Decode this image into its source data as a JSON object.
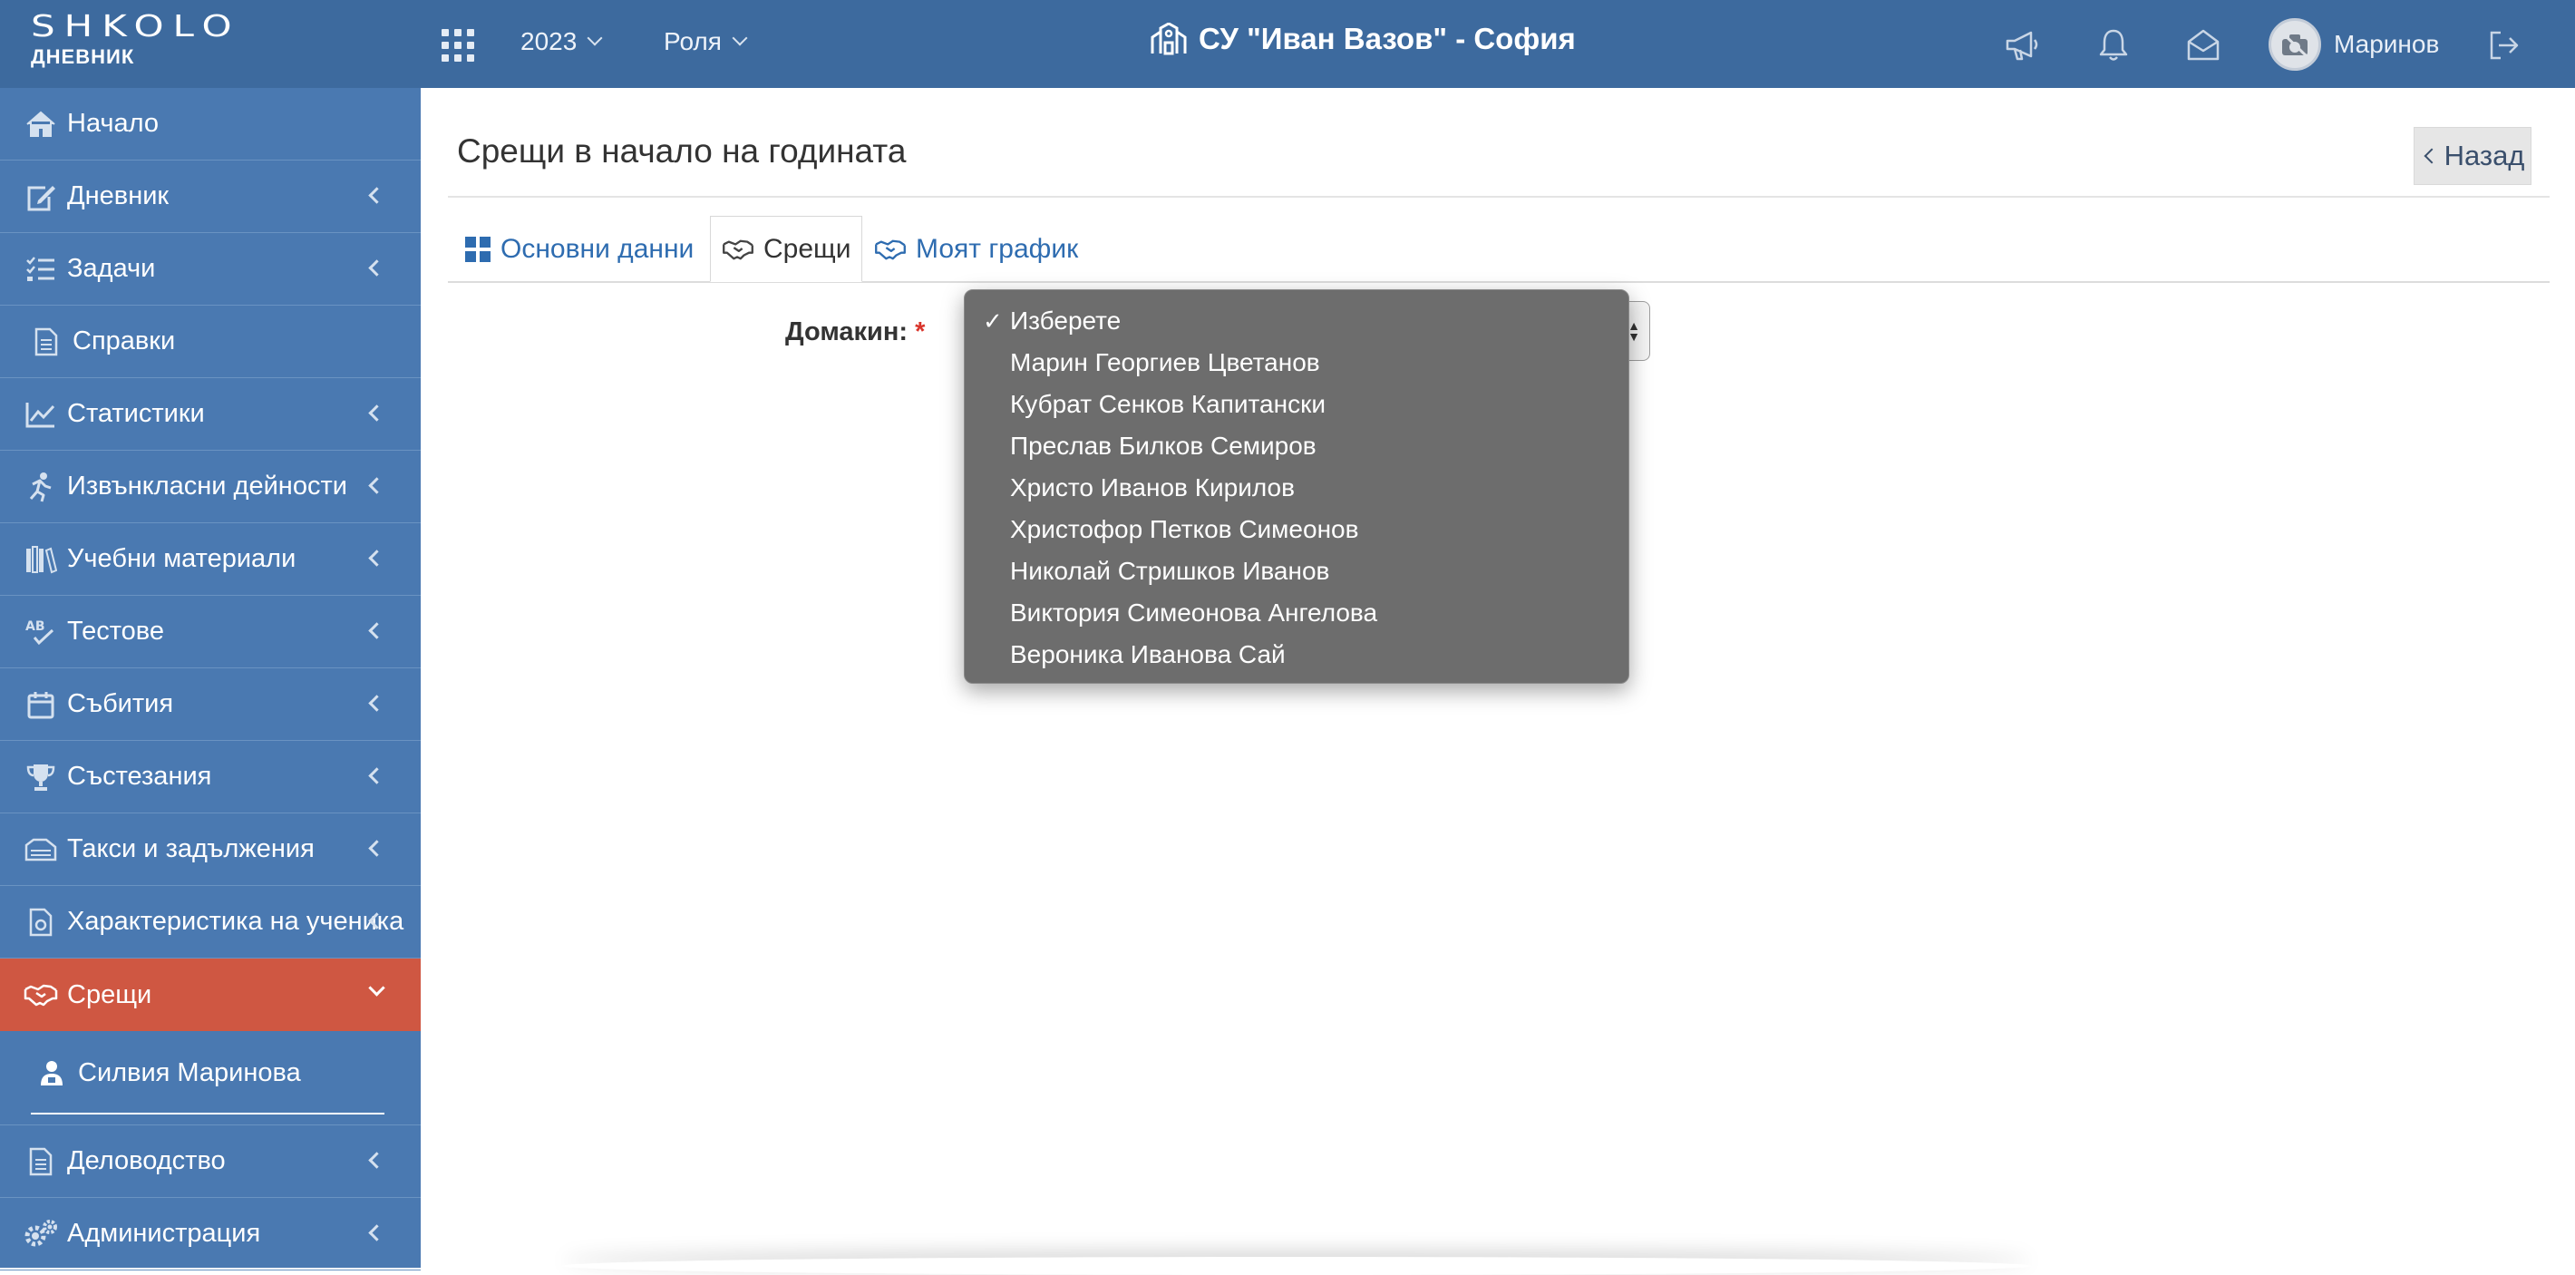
{
  "header": {
    "logo_text": "SHKOLO",
    "logo_sub": "ДНЕВНИК",
    "year_label": "2023",
    "role_label": "Роля",
    "school_title": "СУ \"Иван Вазов\" - София",
    "user_name": "Маринов"
  },
  "sidebar": {
    "items": [
      {
        "label": "Начало",
        "icon": "home-icon"
      },
      {
        "label": "Дневник",
        "icon": "edit-icon"
      },
      {
        "label": "Задачи",
        "icon": "tasks-icon"
      },
      {
        "label": "Справки",
        "icon": "document-icon"
      },
      {
        "label": "Статистики",
        "icon": "line-chart-icon"
      },
      {
        "label": "Извънкласни дейности",
        "icon": "running-icon"
      },
      {
        "label": "Учебни материали",
        "icon": "books-icon"
      },
      {
        "label": "Тестове",
        "icon": "spellcheck-icon"
      },
      {
        "label": "Събития",
        "icon": "calendar-icon"
      },
      {
        "label": "Състезания",
        "icon": "trophy-icon"
      },
      {
        "label": "Такси и задължения",
        "icon": "money-icon"
      },
      {
        "label": "Характеристика на ученика",
        "icon": "file-icon"
      },
      {
        "label": "Срещи",
        "icon": "handshake-icon"
      }
    ],
    "sub_item": {
      "label": "Силвия Маринова",
      "icon": "teacher-icon"
    },
    "bottom_items": [
      {
        "label": "Деловодство",
        "icon": "document-icon"
      },
      {
        "label": "Администрация",
        "icon": "cogs-icon"
      }
    ]
  },
  "main": {
    "page_title": "Срещи в начало на годината",
    "back_label": "Назад",
    "tabs": [
      {
        "label": "Основни данни"
      },
      {
        "label": "Срещи"
      },
      {
        "label": "Моят график"
      }
    ],
    "host_label": "Домакин:",
    "required_mark": "*"
  },
  "dropdown": {
    "options": [
      "Изберете",
      "Марин Георгиев Цветанов",
      "Кубрат Сенков Капитански",
      "Преслав Билков Семиров",
      "Христо Иванов Кирилов",
      "Христофор Петков Симеонов",
      "Николай Стришков Иванов",
      "Виктория Симеонова Ангелова",
      "Вероника Иванова Сай"
    ],
    "selected_index": 0,
    "check_mark": "✓"
  },
  "colors": {
    "topbar": "#3d6a9e",
    "sidebar": "#4a79b1",
    "active_item": "#cf5742",
    "link": "#2e6cb0",
    "dropdown_bg": "#6d6d6d"
  }
}
